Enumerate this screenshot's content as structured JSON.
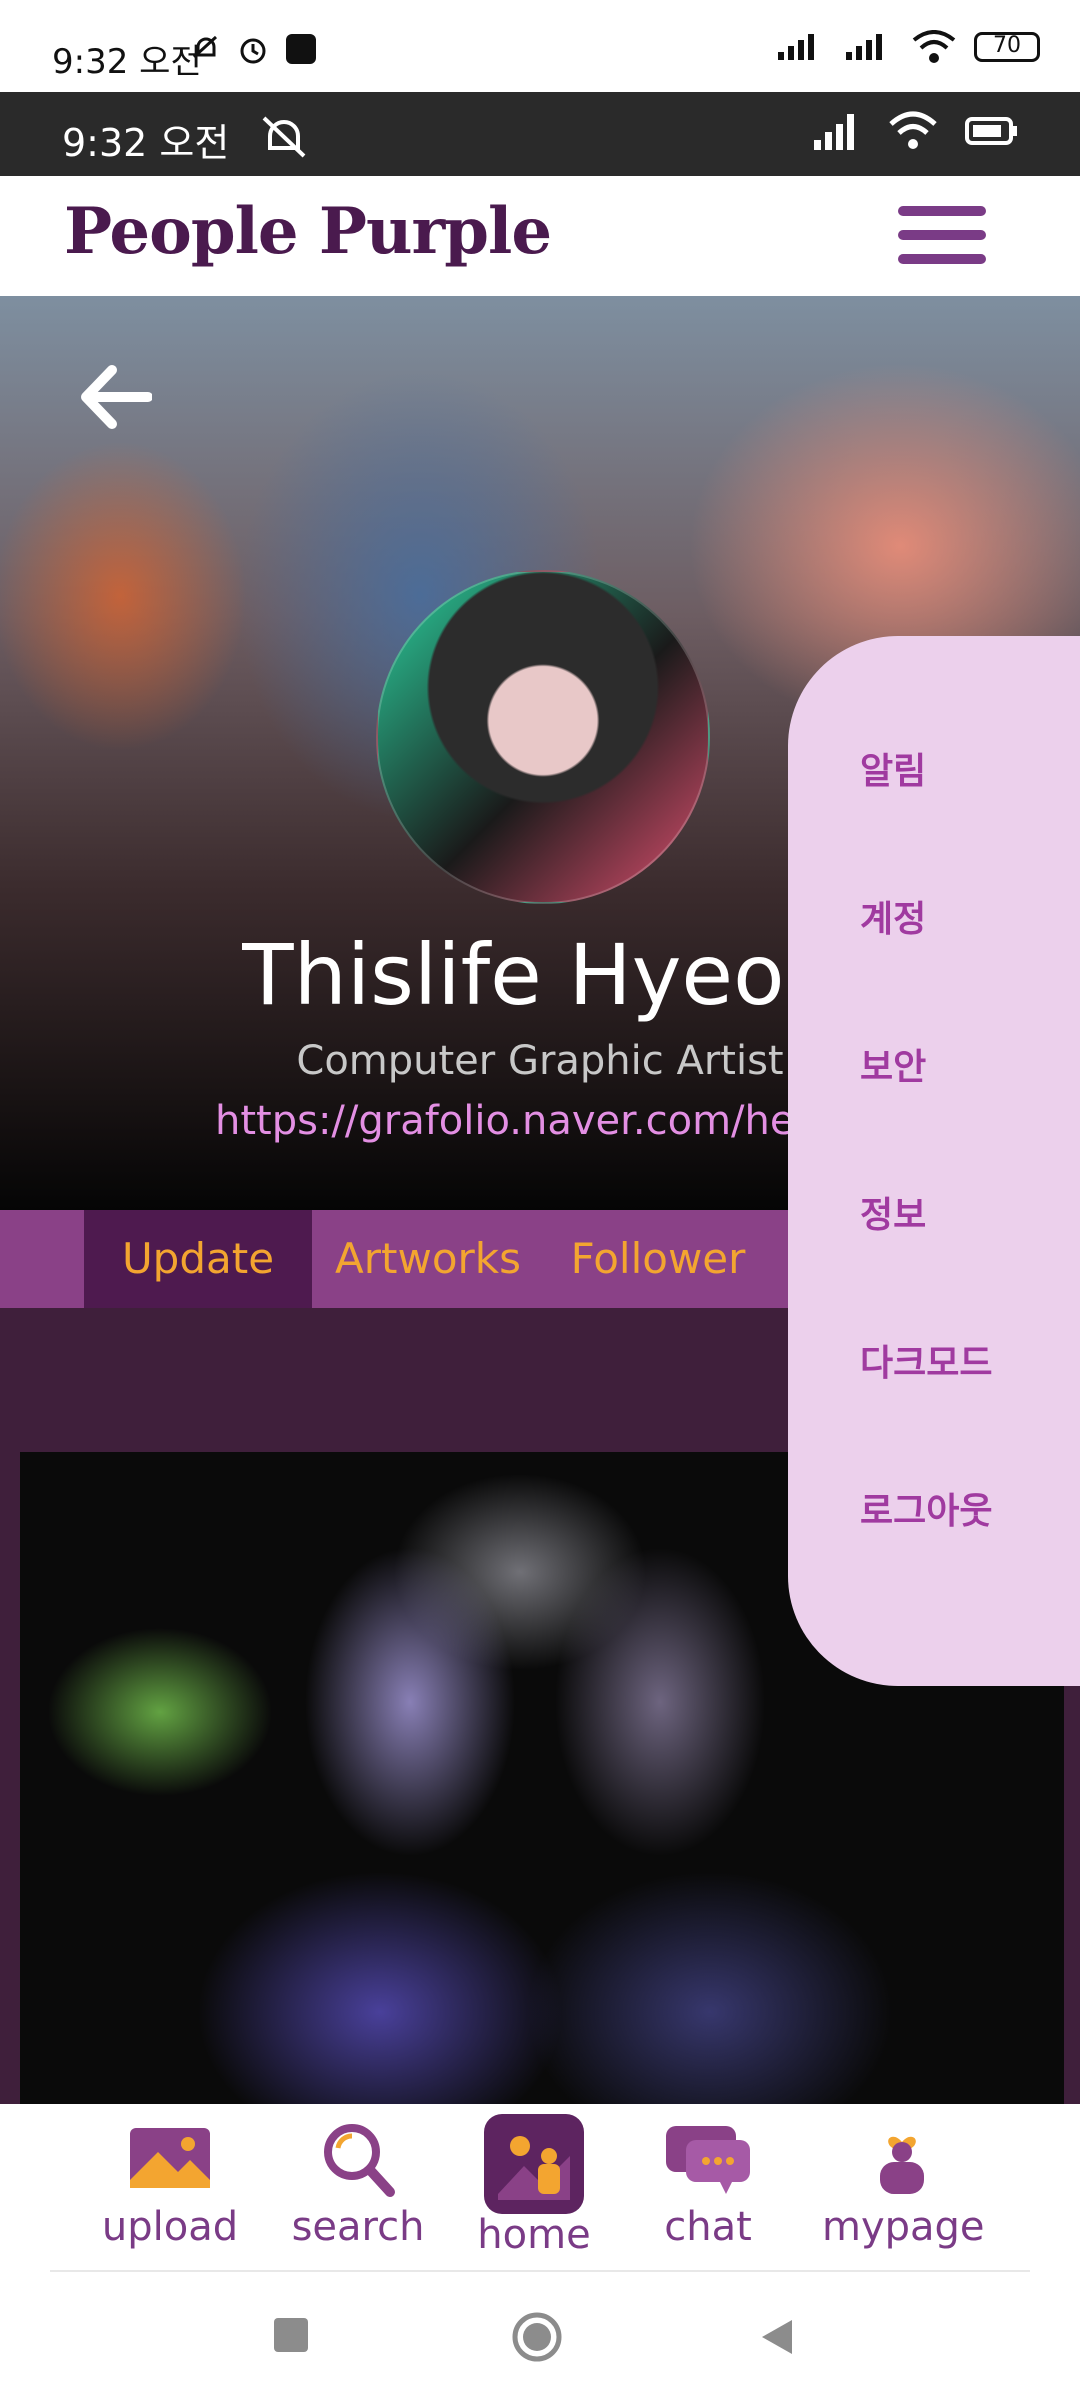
{
  "system_status": {
    "time": "9:32 오전",
    "battery": "70"
  },
  "app_status": {
    "time": "9:32 오전"
  },
  "header": {
    "brand": "People Purple"
  },
  "profile": {
    "name": "Thislife Hyeon",
    "role": "Computer Graphic Artist",
    "link": "https://grafolio.naver.com/heww"
  },
  "tabs": [
    {
      "label": "Update",
      "active": true
    },
    {
      "label": "Artworks",
      "active": false
    },
    {
      "label": "Follower",
      "active": false
    }
  ],
  "side_menu": {
    "items": [
      "알림",
      "계정",
      "보안",
      "정보",
      "다크모드",
      "로그아웃"
    ]
  },
  "bottom_nav": {
    "items": [
      "upload",
      "search",
      "home",
      "chat",
      "mypage"
    ],
    "active": "home"
  },
  "colors": {
    "brand": "#4a1a4e",
    "accent_purple": "#8a4187",
    "active_tab": "#4e1a4f",
    "tab_text": "#f3a530",
    "menu_bg": "#ecd0ec",
    "menu_text": "#a03aa0",
    "content_bg": "#3f1f3b",
    "link": "#e38fe3"
  },
  "icons": [
    "back-arrow-icon",
    "hamburger-menu-icon",
    "image-icon",
    "search-icon",
    "home-icon",
    "chat-icon",
    "mypage-icon"
  ]
}
